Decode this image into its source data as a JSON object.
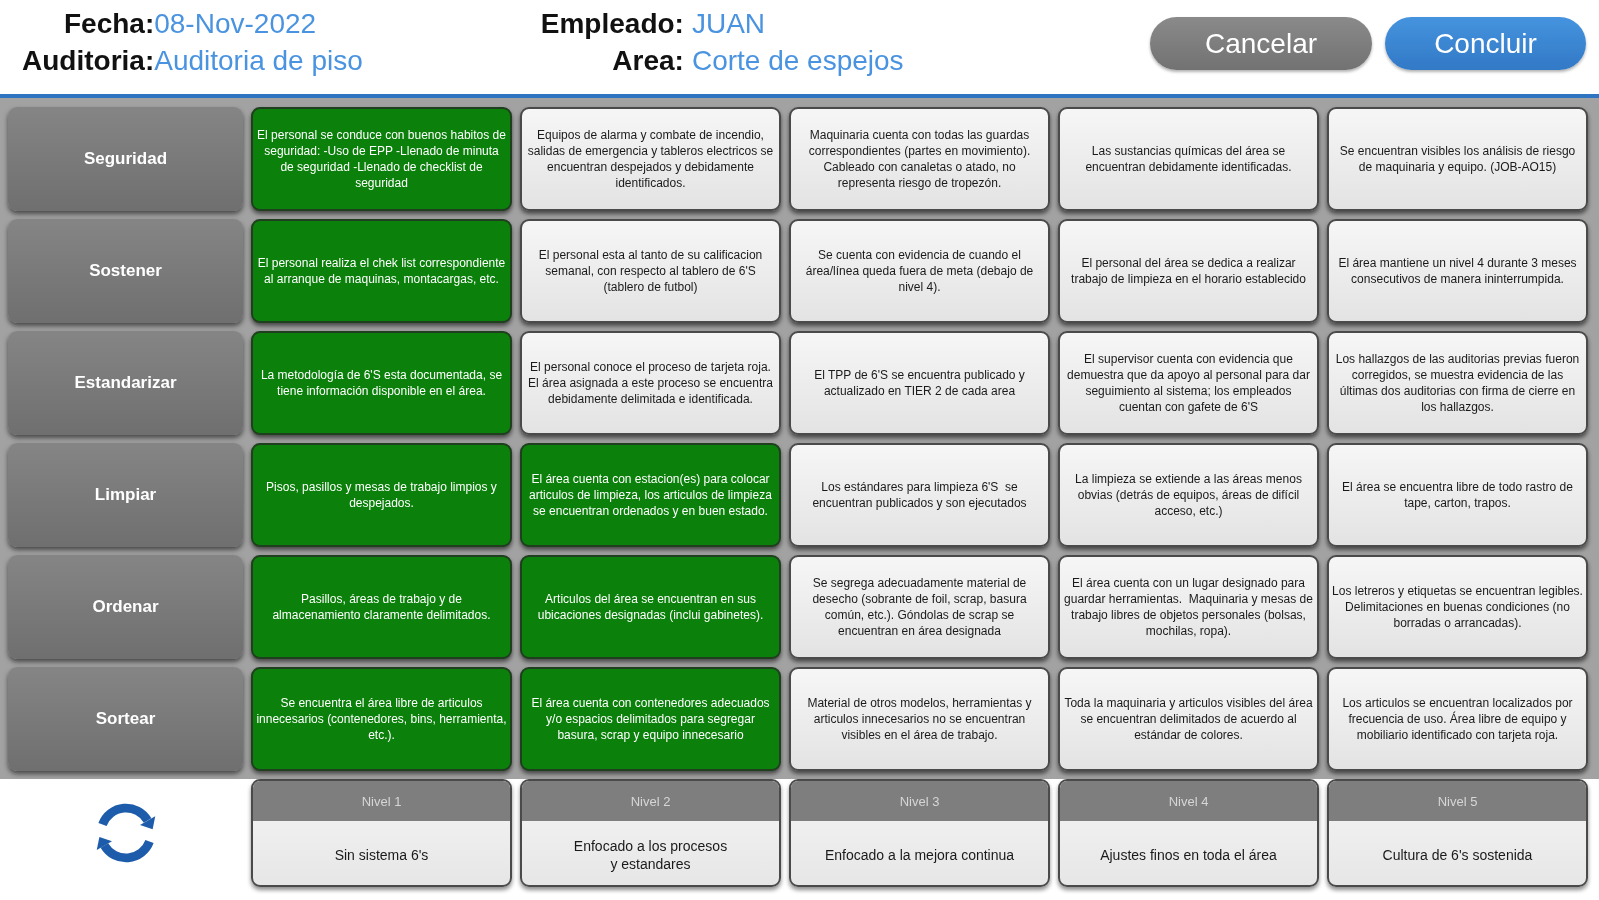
{
  "header": {
    "left_fields": [
      {
        "label": "Fecha:",
        "value": "08-Nov-2022"
      },
      {
        "label": "Auditoria:",
        "value": "Auditoria de piso"
      }
    ],
    "right_fields": [
      {
        "label": "Empleado:",
        "value": "JUAN"
      },
      {
        "label": "Area:",
        "value": "Corte de espejos"
      }
    ],
    "buttons": [
      {
        "label": "Cancelar",
        "kind": "secondary"
      },
      {
        "label": "Concluir",
        "kind": "primary"
      }
    ]
  },
  "matrix": {
    "rows": [
      {
        "category": "Seguridad",
        "cells": [
          {
            "text": "El personal se conduce con buenos habitos de seguridad: -Uso de EPP -Llenado de minuta de seguridad -Llenado de checklist de seguridad",
            "selected": true
          },
          {
            "text": "Equipos de alarma y combate de incendio, salidas de emergencia y tableros electricos se encuentran despejados y debidamente identificados.",
            "selected": false
          },
          {
            "text": "Maquinaria cuenta con todas las guardas correspondientes (partes en movimiento).  Cableado con canaletas o atado, no representa riesgo de tropezón.",
            "selected": false
          },
          {
            "text": "Las sustancias químicas del área se encuentran debidamente identificadas.",
            "selected": false
          },
          {
            "text": "Se encuentran visibles los análisis de riesgo de maquinaria y equipo. (JOB-AO15)",
            "selected": false
          }
        ]
      },
      {
        "category": "Sostener",
        "cells": [
          {
            "text": "El personal realiza el chek list correspondiente al arranque de maquinas, montacargas, etc.",
            "selected": true
          },
          {
            "text": "El personal esta al tanto de su calificacion semanal, con respecto al tablero de 6'S (tablero de futbol)",
            "selected": false
          },
          {
            "text": "Se cuenta con evidencia de cuando el área/línea queda fuera de meta (debajo de nivel 4).",
            "selected": false
          },
          {
            "text": "El personal del área se dedica a realizar trabajo de limpieza en el horario establecido",
            "selected": false
          },
          {
            "text": "El área mantiene un nivel 4 durante 3 meses consecutivos de manera ininterrumpida.",
            "selected": false
          }
        ]
      },
      {
        "category": "Estandarizar",
        "cells": [
          {
            "text": "La metodología de 6'S esta documentada, se tiene información disponible en el área.",
            "selected": true
          },
          {
            "text": "El personal conoce el proceso de tarjeta roja. El área asignada a este proceso se encuentra debidamente delimitada e identificada.",
            "selected": false
          },
          {
            "text": "El TPP de 6'S se encuentra publicado y actualizado en TIER 2 de cada area",
            "selected": false
          },
          {
            "text": "El supervisor cuenta con evidencia que demuestra que da apoyo al personal para dar seguimiento al sistema; los empleados cuentan con gafete de 6'S",
            "selected": false
          },
          {
            "text": "Los hallazgos de las auditorias previas fueron corregidos, se muestra evidencia de las últimas dos auditorias con firma de cierre en los hallazgos.",
            "selected": false
          }
        ]
      },
      {
        "category": "Limpiar",
        "cells": [
          {
            "text": "Pisos, pasillos y mesas de trabajo limpios y despejados.",
            "selected": true
          },
          {
            "text": "El área cuenta con estacion(es) para colocar articulos de limpieza, los articulos de limpieza se encuentran ordenados y en buen estado.",
            "selected": true
          },
          {
            "text": "Los estándares para limpieza 6'S  se encuentran publicados y son ejecutados",
            "selected": false
          },
          {
            "text": "La limpieza se extiende a las áreas menos obvias (detrás de equipos, áreas de difícil acceso, etc.)",
            "selected": false
          },
          {
            "text": "El área se encuentra libre de todo rastro de tape, carton, trapos.",
            "selected": false
          }
        ]
      },
      {
        "category": "Ordenar",
        "cells": [
          {
            "text": "Pasillos, áreas de trabajo y de almacenamiento claramente delimitados.",
            "selected": true
          },
          {
            "text": "Articulos del área se encuentran en sus ubicaciones designadas (inclui gabinetes).",
            "selected": true
          },
          {
            "text": "Se segrega adecuadamente material de desecho (sobrante de foil, scrap, basura común, etc.). Góndolas de scrap se encuentran en área designada",
            "selected": false
          },
          {
            "text": "El área cuenta con un lugar designado para guardar herramientas.  Maquinaria y mesas de trabajo libres de objetos personales (bolsas, mochilas, ropa).",
            "selected": false
          },
          {
            "text": "Los letreros y etiquetas se encuentran legibles. Delimitaciones en buenas condiciones (no borradas o arrancadas).",
            "selected": false
          }
        ]
      },
      {
        "category": "Sortear",
        "cells": [
          {
            "text": "Se encuentra el área libre de articulos innecesarios (contenedores, bins, herramienta, etc.).",
            "selected": true
          },
          {
            "text": "El área cuenta con contenedores adecuados y/o espacios delimitados para segregar basura, scrap y equipo innecesario",
            "selected": true
          },
          {
            "text": "Material de otros modelos, herramientas y articulos innecesarios no se encuentran visibles en el área de trabajo.",
            "selected": false
          },
          {
            "text": "Toda la maquinaria y articulos visibles del área se encuentran delimitados de acuerdo al estándar de colores.",
            "selected": false
          },
          {
            "text": "Los articulos se encuentran localizados por frecuencia de uso. Área libre de equipo y mobiliario identificado con tarjeta roja.",
            "selected": false
          }
        ]
      }
    ],
    "levels": [
      {
        "title": "Nivel 1",
        "description": "Sin sistema 6's"
      },
      {
        "title": "Nivel 2",
        "description": "Enfocado a los procesos\ny estandares"
      },
      {
        "title": "Nivel 3",
        "description": "Enfocado a la mejora continua"
      },
      {
        "title": "Nivel 4",
        "description": "Ajustes finos en toda el área"
      },
      {
        "title": "Nivel 5",
        "description": "Cultura de 6's sostenida"
      }
    ]
  }
}
